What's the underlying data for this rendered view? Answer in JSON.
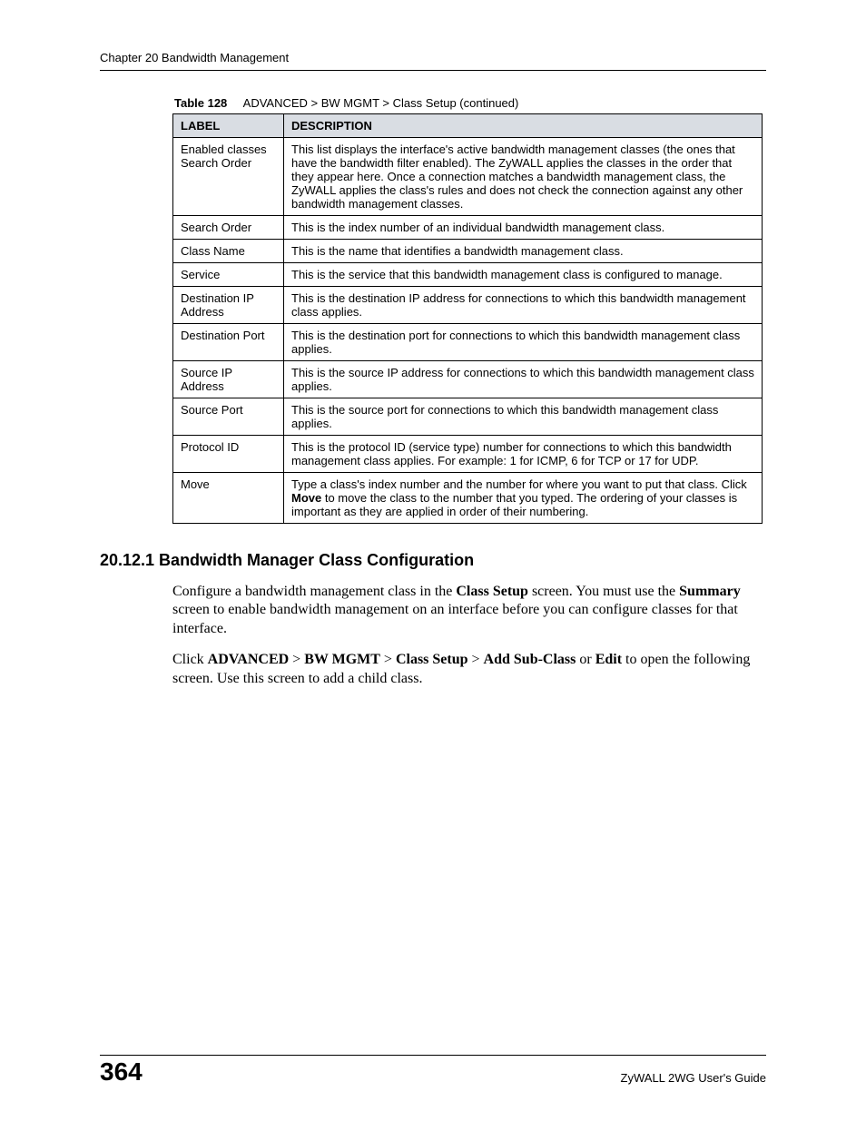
{
  "header": {
    "running": "Chapter 20 Bandwidth Management"
  },
  "table": {
    "caption_label": "Table 128",
    "caption_path": "ADVANCED > BW MGMT > Class Setup (continued)",
    "columns": {
      "label": "LABEL",
      "description": "DESCRIPTION"
    },
    "rows": [
      {
        "label": "Enabled classes Search Order",
        "desc": "This list displays the interface's active bandwidth management classes (the ones that have the bandwidth filter enabled). The ZyWALL applies the classes in the order that they appear here. Once a connection matches a bandwidth management class, the ZyWALL applies the class's rules and does not check the connection against any other bandwidth management classes."
      },
      {
        "label": "Search Order",
        "desc": "This is the index number of an individual bandwidth management class."
      },
      {
        "label": "Class Name",
        "desc": "This is the name that identifies a bandwidth management class."
      },
      {
        "label": "Service",
        "desc": "This is the service that this bandwidth management class is configured to manage."
      },
      {
        "label": "Destination IP Address",
        "desc": "This is the destination IP address for connections to which this bandwidth management class applies."
      },
      {
        "label": "Destination Port",
        "desc": "This is the destination port for connections to which this bandwidth management class applies."
      },
      {
        "label": "Source IP Address",
        "desc": "This is the source IP address for connections to which this bandwidth management class applies."
      },
      {
        "label": "Source Port",
        "desc": "This is the source port for connections to which this bandwidth management class applies."
      },
      {
        "label": "Protocol ID",
        "desc": "This is the protocol ID (service type) number for connections to which this bandwidth management class applies. For example: 1 for ICMP, 6 for TCP or 17 for UDP."
      },
      {
        "label": "Move",
        "desc_pre": "Type a class's index number and the number for where you want to put that class. Click ",
        "desc_bold": "Move",
        "desc_post": " to move the class to the number that you typed. The ordering of your classes is important as they are applied in order of their numbering."
      }
    ]
  },
  "section": {
    "heading": "20.12.1  Bandwidth Manager Class Configuration",
    "para1": {
      "pre": "Configure a bandwidth management class in the ",
      "b1": "Class Setup",
      "mid1": " screen. You must use the ",
      "b2": "Summary",
      "post": " screen to enable bandwidth management on an interface before you can configure classes for that interface."
    },
    "para2": {
      "pre": "Click ",
      "b1": "ADVANCED",
      "s1": " > ",
      "b2": "BW MGMT",
      "s2": " > ",
      "b3": "Class Setup",
      "s3": " > ",
      "b4": "Add Sub-Class",
      "s4": " or ",
      "b5": "Edit",
      "post": " to open the following screen. Use this screen to add a child class."
    }
  },
  "footer": {
    "page": "364",
    "guide": "ZyWALL 2WG User's Guide"
  }
}
